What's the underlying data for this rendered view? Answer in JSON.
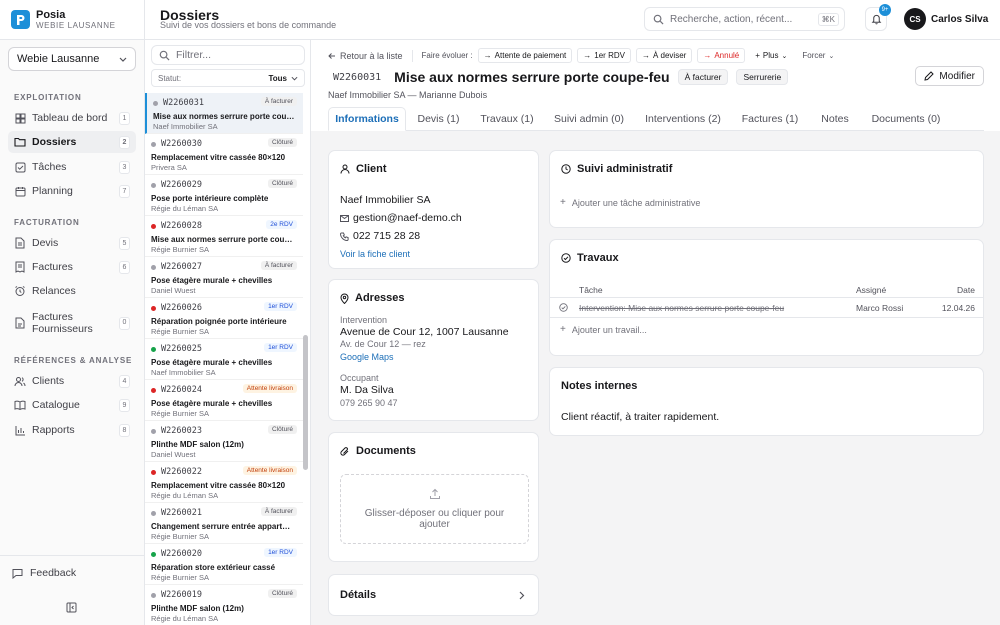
{
  "brand": {
    "name": "Posia",
    "sub": "WEBIE LAUSANNE"
  },
  "header": {
    "title": "Dossiers",
    "subtitle": "Suivi de vos dossiers et bons de commande"
  },
  "search": {
    "placeholder": "Recherche, action, récent...",
    "shortcut": "⌘K"
  },
  "notifications": {
    "count": "9+"
  },
  "user": {
    "initials": "CS",
    "name": "Carlos Silva"
  },
  "sidebar": {
    "company": "Webie Lausanne",
    "sections": [
      "EXPLOITATION",
      "FACTURATION",
      "RÉFÉRENCES & ANALYSE"
    ],
    "items": [
      {
        "label": "Tableau de bord",
        "count": "1"
      },
      {
        "label": "Dossiers",
        "count": "2"
      },
      {
        "label": "Tâches",
        "count": "3"
      },
      {
        "label": "Planning",
        "count": "7"
      },
      {
        "label": "Devis",
        "count": "5"
      },
      {
        "label": "Factures",
        "count": "6"
      },
      {
        "label": "Relances",
        "count": ""
      },
      {
        "label": "Factures Fournisseurs",
        "count": "0"
      },
      {
        "label": "Clients",
        "count": "4"
      },
      {
        "label": "Catalogue",
        "count": "9"
      },
      {
        "label": "Rapports",
        "count": "8"
      }
    ],
    "feedback": "Feedback"
  },
  "list": {
    "filter_placeholder": "Filtrer...",
    "status_label": "Statut:",
    "status_value": "Tous",
    "items": [
      {
        "code": "W2260031",
        "status": "À facturer",
        "title": "Mise aux normes serrure porte coupe-feu",
        "client": "Naef Immobilier SA"
      },
      {
        "code": "W2260030",
        "status": "Clôturé",
        "title": "Remplacement vitre cassée 80×120",
        "client": "Privera SA"
      },
      {
        "code": "W2260029",
        "status": "Clôturé",
        "title": "Pose porte intérieure complète",
        "client": "Régie du Léman SA"
      },
      {
        "code": "W2260028",
        "status": "2e RDV",
        "title": "Mise aux normes serrure porte coupe-feu",
        "client": "Régie Burnier SA"
      },
      {
        "code": "W2260027",
        "status": "À facturer",
        "title": "Pose étagère murale + chevilles",
        "client": "Daniel Wuest"
      },
      {
        "code": "W2260026",
        "status": "1er RDV",
        "title": "Réparation poignée porte intérieure",
        "client": "Régie Burnier SA"
      },
      {
        "code": "W2260025",
        "status": "1er RDV",
        "title": "Pose étagère murale + chevilles",
        "client": "Naef Immobilier SA"
      },
      {
        "code": "W2260024",
        "status": "Attente livraison",
        "title": "Pose étagère murale + chevilles",
        "client": "Régie Burnier SA"
      },
      {
        "code": "W2260023",
        "status": "Clôturé",
        "title": "Plinthe MDF salon (12m)",
        "client": "Daniel Wuest"
      },
      {
        "code": "W2260022",
        "status": "Attente livraison",
        "title": "Remplacement vitre cassée 80×120",
        "client": "Régie du Léman SA"
      },
      {
        "code": "W2260021",
        "status": "À facturer",
        "title": "Changement serrure entrée appartement",
        "client": "Régie Burnier SA"
      },
      {
        "code": "W2260020",
        "status": "1er RDV",
        "title": "Réparation store extérieur cassé",
        "client": "Régie Burnier SA"
      },
      {
        "code": "W2260019",
        "status": "Clôturé",
        "title": "Plinthe MDF salon (12m)",
        "client": "Régie du Léman SA"
      }
    ]
  },
  "toolbar": {
    "back": "Retour à la liste",
    "evolve": "Faire évoluer :",
    "actions": [
      "Attente de paiement",
      "1er RDV",
      "À deviser",
      "Annulé",
      "Plus"
    ],
    "force": "Forcer"
  },
  "dossier": {
    "code": "W2260031",
    "title": "Mise aux normes serrure porte coupe-feu",
    "tags": [
      "À facturer",
      "Serrurerie"
    ],
    "subtitle": "Naef Immobilier SA — Marianne Dubois",
    "edit": "Modifier"
  },
  "tabs": [
    "Informations",
    "Devis (1)",
    "Travaux (1)",
    "Suivi admin (0)",
    "Interventions (2)",
    "Factures (1)",
    "Notes",
    "Documents (0)"
  ],
  "client": {
    "heading": "Client",
    "name": "Naef Immobilier SA",
    "email": "gestion@naef-demo.ch",
    "phone": "022 715 28 28",
    "link": "Voir la fiche client"
  },
  "addresses": {
    "heading": "Adresses",
    "intervention_label": "Intervention",
    "intervention_street": "Avenue de Cour 12, 1007 Lausanne",
    "intervention_detail": "Av. de Cour 12 — rez",
    "maps": "Google Maps",
    "occupant_label": "Occupant",
    "occupant_name": "M. Da Silva",
    "occupant_phone": "079 265 90 47"
  },
  "documents": {
    "heading": "Documents",
    "drop_line1": "Glisser-déposer ou cliquer pour",
    "drop_line2": "ajouter"
  },
  "details": {
    "heading": "Détails"
  },
  "admin": {
    "heading": "Suivi administratif",
    "add": "Ajouter une tâche administrative"
  },
  "work": {
    "heading": "Travaux",
    "columns": [
      "Tâche",
      "Assigné",
      "Date"
    ],
    "rows": [
      {
        "task": "Intervention: Mise aux normes serrure porte coupe-feu",
        "assignee": "Marco Rossi",
        "date": "12.04.26"
      }
    ],
    "add": "Ajouter un travail..."
  },
  "notes": {
    "heading": "Notes internes",
    "text": "Client réactif, à traiter rapidement."
  },
  "colors": {
    "accent": "#1d8fd8",
    "link": "#1d6fb8",
    "danger": "#dc2626",
    "green": "#16a34a",
    "red": "#dc2626",
    "grey": "#a1a1aa"
  }
}
